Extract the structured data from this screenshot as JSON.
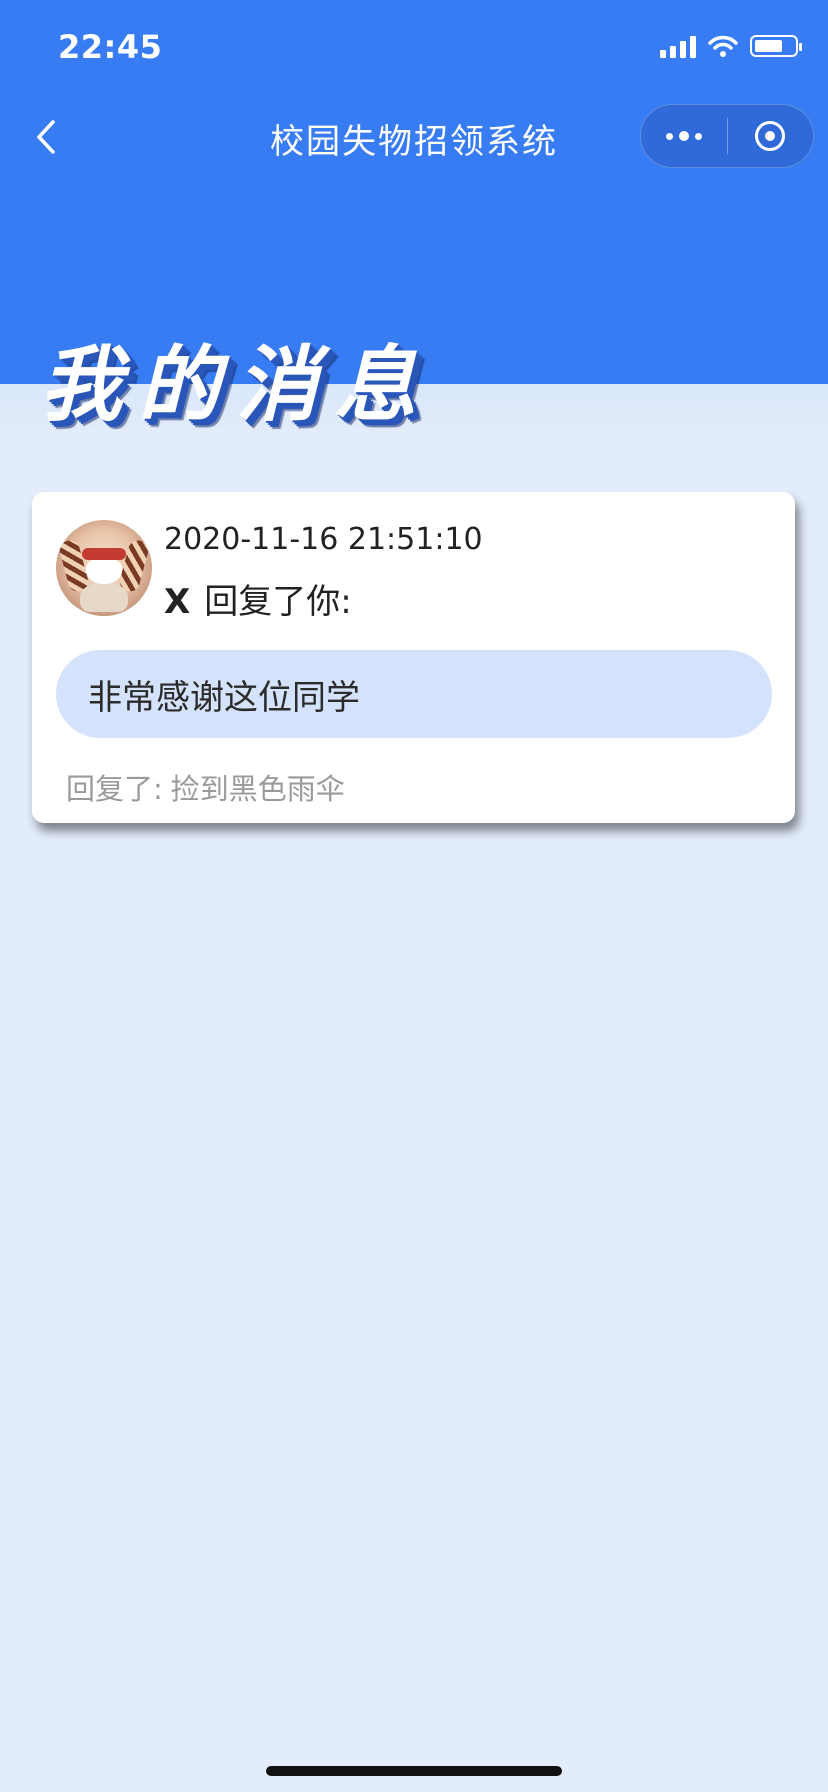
{
  "status_bar": {
    "time": "22:45",
    "battery_level": 0.7
  },
  "nav": {
    "title": "校园失物招领系统",
    "back_icon": "chevron-left-icon",
    "more_icon": "more-dots-icon",
    "close_icon": "target-circle-icon"
  },
  "page": {
    "title": "我的消息"
  },
  "message": {
    "time": "2020-11-16 21:51:10",
    "sender": "X",
    "action": "回复了你:",
    "content": "非常感谢这位同学",
    "reply_label": "回复了:",
    "reply_target": "捡到黑色雨伞",
    "avatar_icon": "user-avatar-image"
  },
  "colors": {
    "header_blue": "#377cf2",
    "page_bg": "#e2ecfa",
    "bubble_bg": "#d4e3fb"
  }
}
